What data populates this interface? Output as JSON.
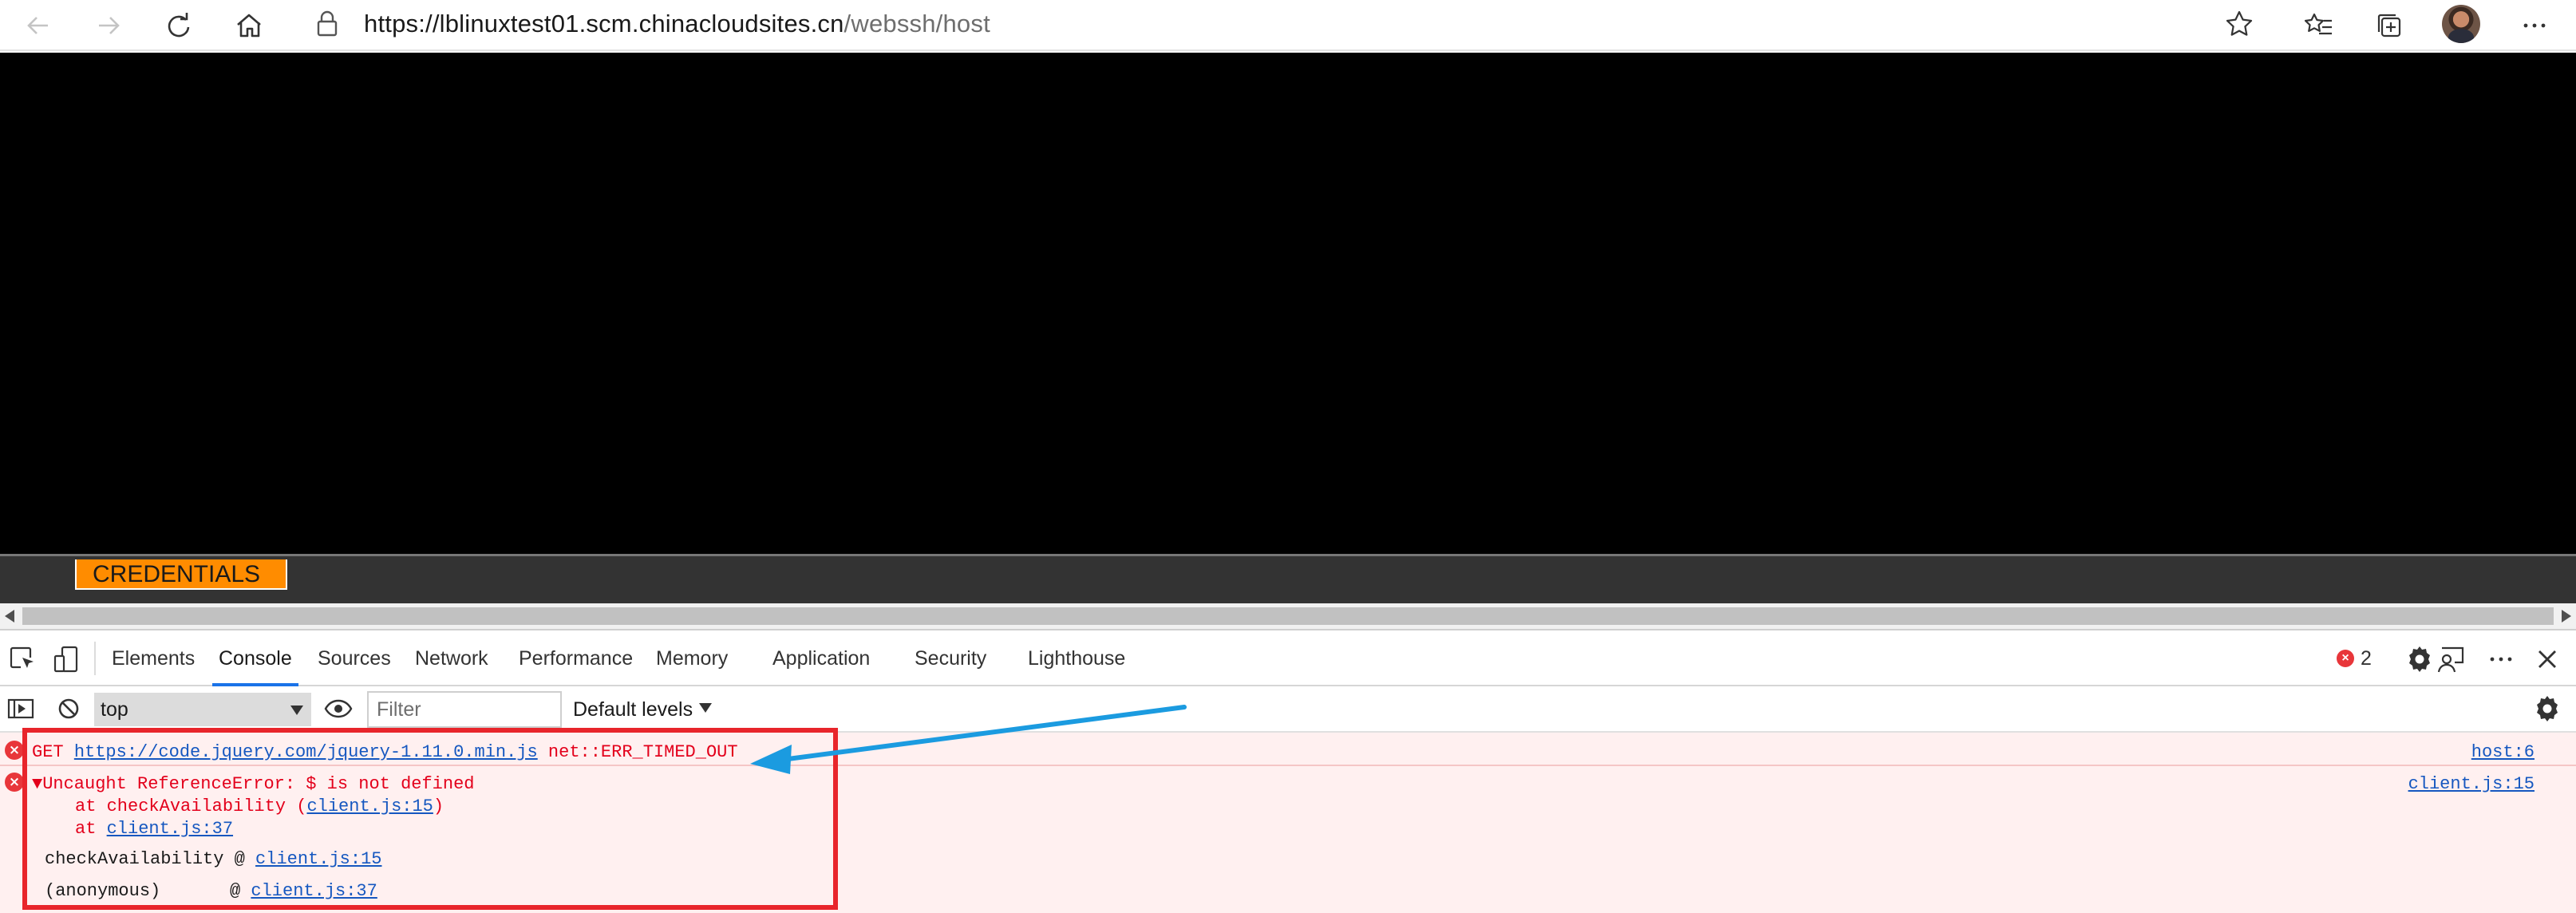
{
  "browser": {
    "url_host": "https://lblinuxtest01.scm.chinacloudsites.cn",
    "url_path": "/webssh/host"
  },
  "page": {
    "credentials_label": "CREDENTIALS"
  },
  "devtools": {
    "tabs": [
      {
        "label": "Elements"
      },
      {
        "label": "Console"
      },
      {
        "label": "Sources"
      },
      {
        "label": "Network"
      },
      {
        "label": "Performance"
      },
      {
        "label": "Memory"
      },
      {
        "label": "Application"
      },
      {
        "label": "Security"
      },
      {
        "label": "Lighthouse"
      }
    ],
    "active_tab": "Console",
    "error_count": "2",
    "context": "top",
    "filter_placeholder": "Filter",
    "levels_label": "Default levels",
    "console": {
      "msg1": {
        "method": "GET",
        "url": "https://code.jquery.com/jquery-1.11.0.min.js",
        "error": "net::ERR_TIMED_OUT",
        "source": "host:6"
      },
      "msg2": {
        "toggle": "▼",
        "text": "Uncaught ReferenceError: $ is not defined",
        "source": "client.js:15",
        "stack1_prefix": "at checkAvailability (",
        "stack1_link": "client.js:15",
        "stack1_suffix": ")",
        "stack2_prefix": "at ",
        "stack2_link": "client.js:37",
        "frames": [
          {
            "fn": "checkAvailability",
            "at": "@",
            "link": "client.js:15"
          },
          {
            "fn": "(anonymous)",
            "at": "@",
            "link": "client.js:37"
          }
        ]
      }
    }
  },
  "colors": {
    "accent_blue": "#1a73e8",
    "error_red": "#e3001b",
    "annotation_red": "#e8252b",
    "annotation_arrow": "#1b9be0",
    "credentials_orange": "#ff8c00"
  }
}
